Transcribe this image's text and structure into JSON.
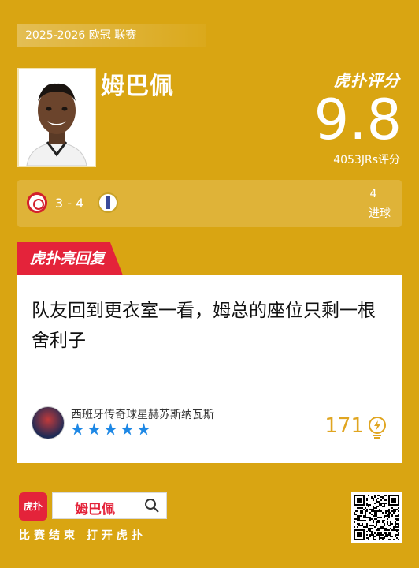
{
  "season": "2025-2026 欧冠 联赛",
  "player": {
    "name": "姆巴佩"
  },
  "brand": {
    "logo": "虎扑评分"
  },
  "rating": {
    "score": "9.8",
    "count": "4053JRs评分"
  },
  "match": {
    "score": "3 - 4",
    "home_crest": "olympiacos-crest",
    "away_crest": "real-madrid-crest",
    "goals": "4",
    "goals_label": "进球"
  },
  "highlight": {
    "tab_label": "虎扑亮回复",
    "comment": "队友回到更衣室一看，姆总的座位只剩一根舍利子",
    "user": "西班牙传奇球星赫苏斯纳瓦斯",
    "stars": 5,
    "likes": "171"
  },
  "footer": {
    "app_icon_text": "虎扑",
    "search_text": "姆巴佩",
    "slogan": "比赛结束 打开虎扑"
  },
  "colors": {
    "background": "#d9a512",
    "accent_red": "#e4233a",
    "star_blue": "#1e88e5",
    "like_gold": "#e0a520"
  }
}
